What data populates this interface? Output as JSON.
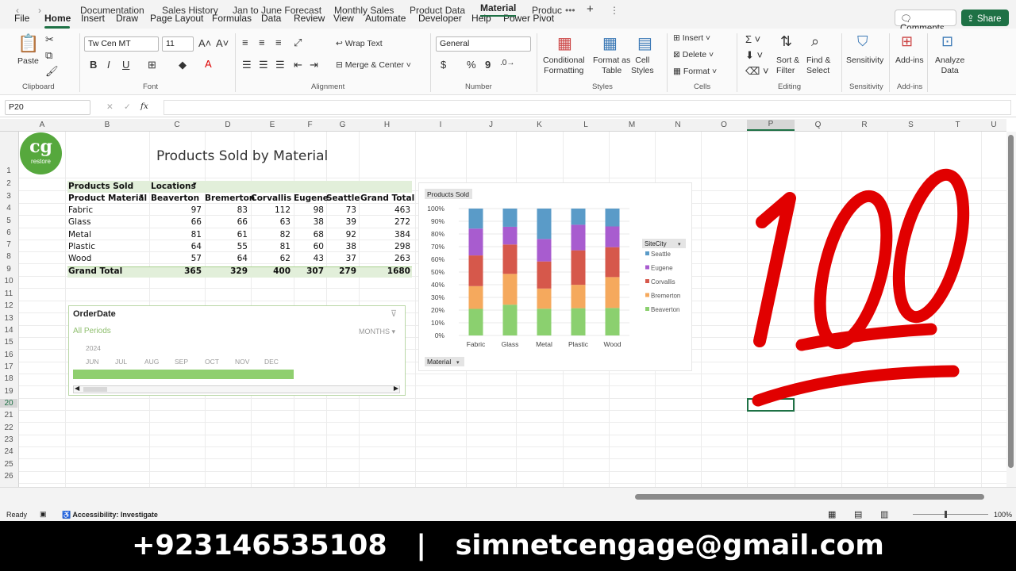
{
  "menu": {
    "items": [
      "File",
      "Home",
      "Insert",
      "Draw",
      "Page Layout",
      "Formulas",
      "Data",
      "Review",
      "View",
      "Automate",
      "Developer",
      "Help",
      "Power Pivot"
    ],
    "comments_label": "Comments",
    "share_label": "Share"
  },
  "ribbon": {
    "clipboard": {
      "paste": "Paste",
      "label": "Clipboard"
    },
    "font": {
      "name": "Tw Cen MT",
      "size": "11",
      "label": "Font",
      "bold": "B",
      "italic": "I",
      "underline": "U"
    },
    "alignment": {
      "wrap": "Wrap Text",
      "merge": "Merge & Center",
      "label": "Alignment"
    },
    "number": {
      "format": "General",
      "label": "Number",
      "currency": "$",
      "percent": "%",
      "comma": "9"
    },
    "styles": {
      "conditional": "Conditional\nFormatting",
      "format_table": "Format as\nTable",
      "cell_styles": "Cell\nStyles",
      "label": "Styles"
    },
    "cells": {
      "insert": "Insert",
      "delete": "Delete",
      "format": "Format",
      "label": "Cells"
    },
    "editing": {
      "sort": "Sort &\nFilter",
      "find": "Find &\nSelect",
      "label": "Editing"
    },
    "sensitivity": {
      "btn": "Sensitivity",
      "label": "Sensitivity"
    },
    "addins": {
      "btn": "Add-ins",
      "label": "Add-ins"
    },
    "analyze": {
      "btn": "Analyze\nData"
    }
  },
  "formula_bar": {
    "name_box": "P20",
    "fx": "fx",
    "value": ""
  },
  "columns": [
    "A",
    "B",
    "C",
    "D",
    "E",
    "F",
    "G",
    "H",
    "I",
    "J",
    "K",
    "L",
    "M",
    "N",
    "O",
    "P",
    "Q",
    "R",
    "S",
    "T",
    "U"
  ],
  "rows": [
    "1",
    "2",
    "3",
    "4",
    "5",
    "6",
    "7",
    "8",
    "9",
    "10",
    "11",
    "12",
    "13",
    "14",
    "15",
    "16",
    "17",
    "18",
    "19",
    "20",
    "21",
    "22",
    "23",
    "24",
    "25",
    "26"
  ],
  "logo": {
    "text": "cg",
    "sub": "restore"
  },
  "sheet_title": "Products Sold by Material",
  "pivot": {
    "header1": "Products Sold",
    "header2": "Locations",
    "row_label": "Product Material",
    "cols": [
      "Beaverton",
      "Bremerton",
      "Corvallis",
      "Eugene",
      "Seattle",
      "Grand Total"
    ],
    "rows": [
      {
        "name": "Fabric",
        "v": [
          "97",
          "83",
          "112",
          "98",
          "73",
          "463"
        ]
      },
      {
        "name": "Glass",
        "v": [
          "66",
          "66",
          "63",
          "38",
          "39",
          "272"
        ]
      },
      {
        "name": "Metal",
        "v": [
          "81",
          "61",
          "82",
          "68",
          "92",
          "384"
        ]
      },
      {
        "name": "Plastic",
        "v": [
          "64",
          "55",
          "81",
          "60",
          "38",
          "298"
        ]
      },
      {
        "name": "Wood",
        "v": [
          "57",
          "64",
          "62",
          "43",
          "37",
          "263"
        ]
      }
    ],
    "total": {
      "name": "Grand Total",
      "v": [
        "365",
        "329",
        "400",
        "307",
        "279",
        "1680"
      ]
    }
  },
  "slicer": {
    "title": "OrderDate",
    "all_periods": "All Periods",
    "level": "MONTHS",
    "year": "2024",
    "months": [
      "JUN",
      "JUL",
      "AUG",
      "SEP",
      "OCT",
      "NOV",
      "DEC"
    ]
  },
  "chart_data": {
    "type": "bar",
    "stacked": "100%",
    "title": "Products Sold",
    "categories": [
      "Fabric",
      "Glass",
      "Metal",
      "Plastic",
      "Wood"
    ],
    "series": [
      {
        "name": "Beaverton",
        "color": "#8bd06f",
        "values": [
          97,
          66,
          81,
          64,
          57
        ]
      },
      {
        "name": "Bremerton",
        "color": "#f5a95d",
        "values": [
          83,
          66,
          61,
          55,
          64
        ]
      },
      {
        "name": "Corvallis",
        "color": "#d6584b",
        "values": [
          112,
          63,
          82,
          81,
          62
        ]
      },
      {
        "name": "Eugene",
        "color": "#a85ccf",
        "values": [
          98,
          38,
          68,
          60,
          43
        ]
      },
      {
        "name": "Seattle",
        "color": "#5a9bc8",
        "values": [
          73,
          39,
          92,
          38,
          37
        ]
      }
    ],
    "yticks": [
      "0%",
      "10%",
      "20%",
      "30%",
      "40%",
      "50%",
      "60%",
      "70%",
      "80%",
      "90%",
      "100%"
    ],
    "legend_title": "SiteCity",
    "axis_field": "Material"
  },
  "tabs": {
    "items": [
      "Documentation",
      "Sales History",
      "Jan to June Forecast",
      "Monthly Sales",
      "Product Data",
      "Material",
      "Produc"
    ],
    "active": "Material"
  },
  "status": {
    "ready": "Ready",
    "accessibility": "Accessibility: Investigate",
    "zoom": "100%"
  },
  "footer": "+923146535108 | simnetcengage@gmail.com",
  "emoji": "100"
}
